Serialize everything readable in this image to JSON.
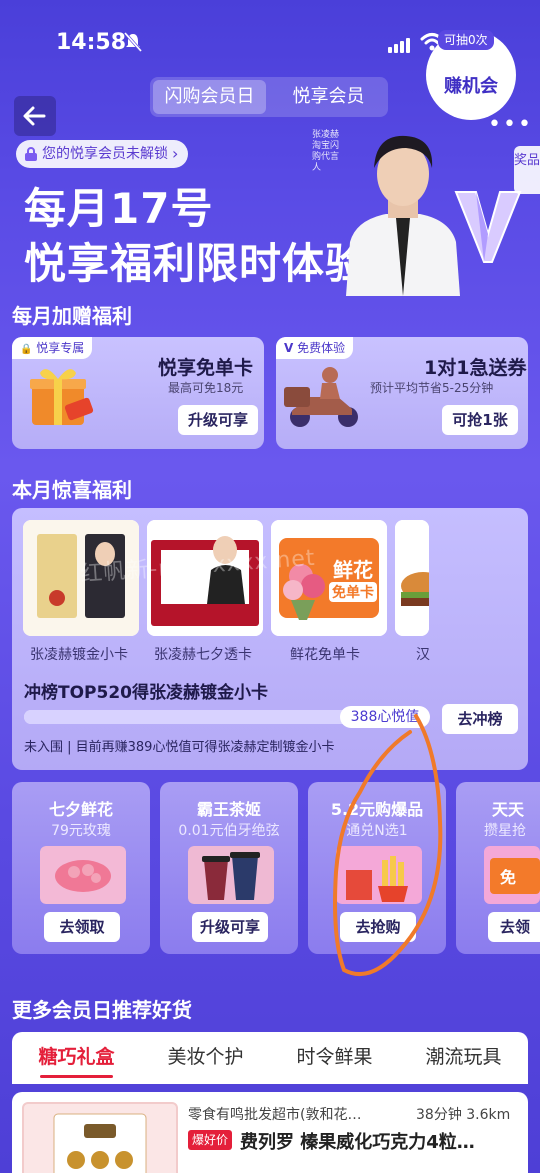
{
  "status": {
    "time": "14:58"
  },
  "header": {
    "tabs": [
      {
        "label": "闪购会员日",
        "active": true
      },
      {
        "label": "悦享会员",
        "active": false
      }
    ]
  },
  "hero": {
    "lock_text": "您的悦享会员未解锁",
    "title1": "每月17号",
    "title2": "悦享福利限时体验",
    "side_tab": "奖品",
    "endorser": "张凌赫 淘宝闪购代言人"
  },
  "monthly": {
    "title": "每月加赠福利",
    "cards": [
      {
        "tag": "悦享专属",
        "title": "悦享免单卡",
        "sub": "最高可免18元",
        "button": "升级可享"
      },
      {
        "tag": "免费体验",
        "title": "1对1急送券",
        "sub": "预计平均节省5-25分钟",
        "button": "可抢1张"
      }
    ]
  },
  "surprise": {
    "title": "本月惊喜福利",
    "items": [
      {
        "caption": "张凌赫镀金小卡"
      },
      {
        "caption": "张凌赫七夕透卡"
      },
      {
        "caption": "鲜花免单卡"
      },
      {
        "caption": "汉"
      }
    ],
    "flower_card_label": "鲜花",
    "flower_card_label2": "免单卡",
    "earn_tag": "可抽0次",
    "earn_label": "赚机会",
    "rank_title": "冲榜TOP520得张凌赫镀金小卡",
    "progress_badge": "388心悦值",
    "progress_fraction": 0.8,
    "rank_button": "去冲榜",
    "rank_note": "未入围 | 目前再赚389心悦值可得张凌赫定制镀金小卡"
  },
  "watermark": "红帆新-new.xxxx.net",
  "promos": [
    {
      "title": "七夕鲜花",
      "sub": "79元玫瑰",
      "button": "去领取"
    },
    {
      "title": "霸王茶姬",
      "sub": "0.01元伯牙绝弦",
      "button": "升级可享"
    },
    {
      "title": "5.2元购爆品",
      "sub": "通兑N选1",
      "button": "去抢购"
    },
    {
      "title": "天天",
      "sub": "攒星抢",
      "button": "去领"
    }
  ],
  "recommend": {
    "title": "更多会员日推荐好货",
    "tabs": [
      "糖巧礼盒",
      "美妆个护",
      "时令鲜果",
      "潮流玩具"
    ],
    "active_tab": 0,
    "item": {
      "shop": "零食有鸣批发超市(敦和花…",
      "distance": "38分钟 3.6km",
      "badge": "爆好价",
      "name": "费列罗 榛果威化巧克力4粒…"
    }
  },
  "colors": {
    "accent": "#5a48e2",
    "recommend_active": "#e41f3a",
    "annotation": "#f07a2a"
  }
}
